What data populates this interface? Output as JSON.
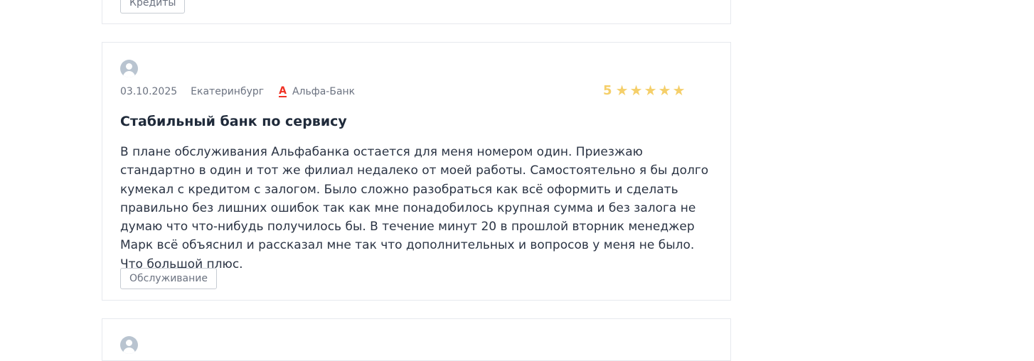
{
  "prev_review": {
    "tag": "Кредиты"
  },
  "review": {
    "date": "03.10.2025",
    "city": "Екатеринбург",
    "bank_logo": "А",
    "bank_name": "Альфа-Банк",
    "rating_value": "5",
    "rating_stars": 5,
    "rating_color": "#f5cf6a",
    "title": "Стабильный банк по сервису",
    "text": "В плане обслуживания Альфабанка остается для меня номером один. Приезжаю стандартно в один и тот же филиал недалеко от моей работы. Самостоятельно я бы долго кумекал с кредитом с залогом. Было сложно разобраться как всё оформить и сделать правильно без лишних ошибок так как мне понадобилось крупная сумма и без залога не думаю что что-нибудь получилось бы. В течение минут 20 в прошлой вторник менеджер Марк всё объяснил и рассказал мне так что дополнительных и вопросов у меня не было. Что большой плюс.",
    "tag": "Обслуживание",
    "avatar_icon": "user-avatar-icon",
    "bank_accent_color": "#ef3124"
  }
}
